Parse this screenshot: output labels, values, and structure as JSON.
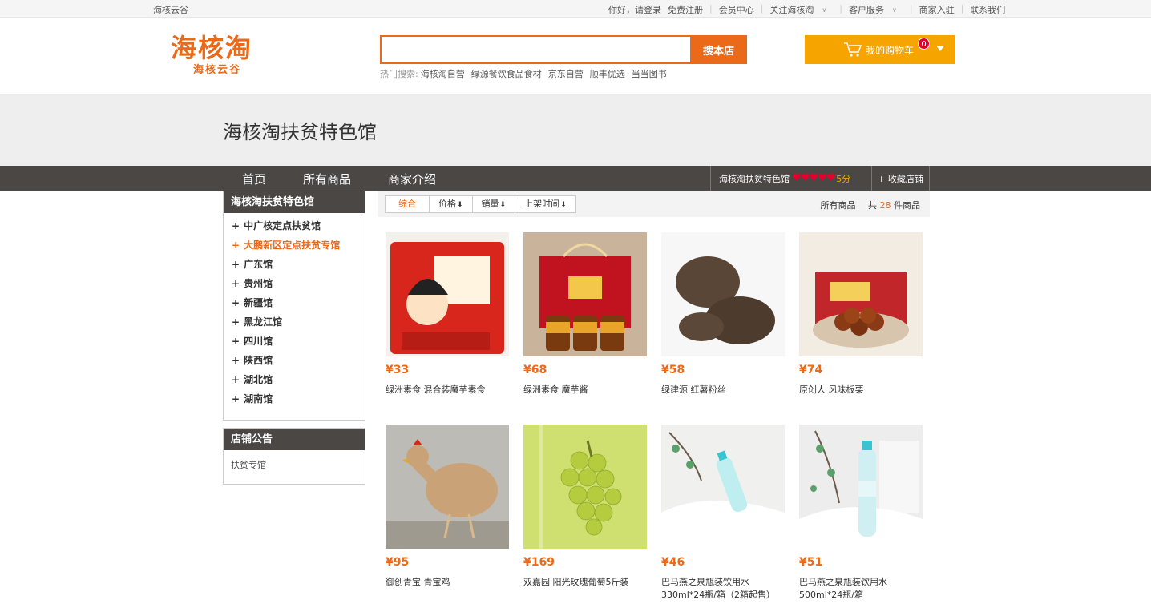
{
  "topbar": {
    "site_name": "海核云谷",
    "greeting": "你好，请登录",
    "register": "免费注册",
    "member": "会员中心",
    "follow": "关注海核淘",
    "service": "客户服务",
    "merchant": "商家入驻",
    "contact": "联系我们"
  },
  "logo": {
    "main": "海核淘",
    "sub": "海核云谷"
  },
  "search": {
    "placeholder": "",
    "button": "搜本店",
    "hot_label": "热门搜索:",
    "hot": [
      "海核淘自营",
      "绿源餐饮食品食材",
      "京东自营",
      "顺丰优选",
      "当当图书"
    ]
  },
  "cart": {
    "label": "我的购物车",
    "count": "0"
  },
  "banner": {
    "title": "海核淘扶贫特色馆"
  },
  "nav": {
    "items": [
      "首页",
      "所有商品",
      "商家介绍"
    ],
    "shop_name": "海核淘扶贫特色馆",
    "hearts": "♥♥♥♥♥",
    "score": "5分",
    "favorite": "+ 收藏店铺"
  },
  "sidebar": {
    "title": "海核淘扶贫特色馆",
    "items": [
      {
        "label": "中广核定点扶贫馆",
        "active": false
      },
      {
        "label": "大鹏新区定点扶贫专馆",
        "active": true
      },
      {
        "label": "广东馆",
        "active": false
      },
      {
        "label": "贵州馆",
        "active": false
      },
      {
        "label": "新疆馆",
        "active": false
      },
      {
        "label": "黑龙江馆",
        "active": false
      },
      {
        "label": "四川馆",
        "active": false
      },
      {
        "label": "陕西馆",
        "active": false
      },
      {
        "label": "湖北馆",
        "active": false
      },
      {
        "label": "湖南馆",
        "active": false
      }
    ],
    "notice_title": "店铺公告",
    "notice_text": "扶贫专馆"
  },
  "sort": {
    "options": [
      "综合",
      "价格",
      "销量",
      "上架时间"
    ],
    "all_label": "所有商品",
    "count_prefix": "共",
    "count": "28",
    "count_suffix": "件商品"
  },
  "products": [
    {
      "price": "¥33",
      "name": "绿洲素食 混合装魔芋素食",
      "image": "konjac-snack-bag"
    },
    {
      "price": "¥68",
      "name": "绿洲素食 魔芋酱",
      "image": "konjac-sauce-giftbox"
    },
    {
      "price": "¥58",
      "name": "绿建源 红薯粉丝",
      "image": "sweet-potato-noodles"
    },
    {
      "price": "¥74",
      "name": "原创人 风味板栗",
      "image": "chestnut-box"
    },
    {
      "price": "¥95",
      "name": "御创青宝 青宝鸡",
      "image": "chicken"
    },
    {
      "price": "¥169",
      "name": "双嘉园 阳光玫瑰葡萄5斤装",
      "image": "green-grapes"
    },
    {
      "price": "¥46",
      "name": "巴马燕之泉瓶装饮用水 330ml*24瓶/箱（2箱起售）",
      "image": "water-bottle-small"
    },
    {
      "price": "¥51",
      "name": "巴马燕之泉瓶装饮用水 500ml*24瓶/箱",
      "image": "water-bottle-large"
    }
  ],
  "colors": {
    "accent": "#ea6a1a",
    "cart": "#f5a400",
    "nav_bg": "#4b4745"
  }
}
